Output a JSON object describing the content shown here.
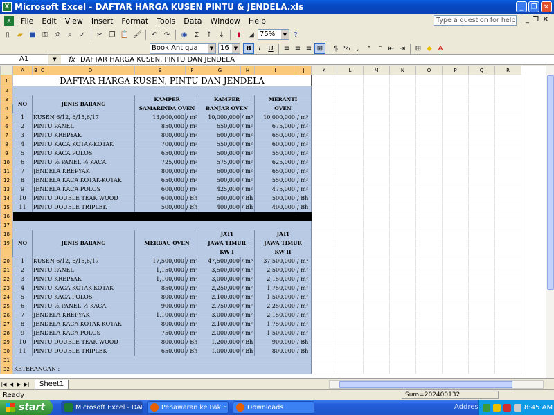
{
  "window": {
    "title": "Microsoft Excel - DAFTAR HARGA KUSEN PINTU & JENDELA.xls"
  },
  "menu": {
    "items": [
      "File",
      "Edit",
      "View",
      "Insert",
      "Format",
      "Tools",
      "Data",
      "Window",
      "Help"
    ],
    "help_placeholder": "Type a question for help"
  },
  "toolbar": {
    "zoom": "75%"
  },
  "format_toolbar": {
    "font": "Book Antiqua",
    "size": "16",
    "bold": "B",
    "italic": "I",
    "underline": "U",
    "currency": "$",
    "percent": "%"
  },
  "formula_bar": {
    "cell": "A1",
    "fx": "fx",
    "content": "DAFTAR HARGA KUSEN, PINTU DAN JENDELA"
  },
  "columns": [
    "A",
    "B",
    "C",
    "D",
    "E",
    "F",
    "G",
    "H",
    "I",
    "J",
    "K",
    "L",
    "M",
    "N",
    "O",
    "P",
    "Q",
    "R"
  ],
  "sheet": {
    "title": "DAFTAR HARGA KUSEN, PINTU DAN JENDELA",
    "table1": {
      "headers": {
        "no": "NO",
        "item": "JENIS BARANG",
        "c1a": "KAMPER",
        "c1b": "SAMARINDA OVEN",
        "c2a": "KAMPER",
        "c2b": "BANJAR OVEN",
        "c3a": "MERANTI",
        "c3b": "OVEN"
      },
      "rows": [
        [
          "1",
          "KUSEN 6/12, 6/15,6/17",
          "13,000,000",
          "/ m³",
          "10,000,000",
          "/ m³",
          "10,000,000",
          "/ m³"
        ],
        [
          "2",
          "PINTU PANEL",
          "850,000",
          "/ m²",
          "650,000",
          "/ m²",
          "675,000",
          "/ m²"
        ],
        [
          "3",
          "PINTU KREPYAK",
          "800,000",
          "/ m²",
          "600,000",
          "/ m²",
          "650,000",
          "/ m²"
        ],
        [
          "4",
          "PINTU KACA KOTAK-KOTAK",
          "700,000",
          "/ m²",
          "550,000",
          "/ m²",
          "600,000",
          "/ m²"
        ],
        [
          "5",
          "PINTU KACA POLOS",
          "650,000",
          "/ m²",
          "500,000",
          "/ m²",
          "550,000",
          "/ m²"
        ],
        [
          "6",
          "PINTU ½ PANEL ½ KACA",
          "725,000",
          "/ m²",
          "575,000",
          "/ m²",
          "625,000",
          "/ m²"
        ],
        [
          "7",
          "JENDELA KREPYAK",
          "800,000",
          "/ m²",
          "600,000",
          "/ m²",
          "650,000",
          "/ m²"
        ],
        [
          "8",
          "JENDELA KACA KOTAK-KOTAK",
          "650,000",
          "/ m²",
          "500,000",
          "/ m²",
          "550,000",
          "/ m²"
        ],
        [
          "9",
          "JENDELA KACA POLOS",
          "600,000",
          "/ m²",
          "425,000",
          "/ m²",
          "475,000",
          "/ m²"
        ],
        [
          "10",
          "PINTU DOUBLE TEAK WOOD",
          "600,000",
          "/ Bh",
          "500,000",
          "/ Bh",
          "500,000",
          "/ Bh"
        ],
        [
          "11",
          "PINTU DOUBLE TRIPLEK",
          "500,000",
          "/ Bh",
          "400,000",
          "/ Bh",
          "400,000",
          "/ Bh"
        ]
      ]
    },
    "table2": {
      "headers": {
        "no": "NO",
        "item": "JENIS BARANG",
        "c1a": "MERBAU OVEN",
        "c2a": "JATI",
        "c2b": "JAWA TIMUR",
        "c2c": "KW I",
        "c3a": "JATI",
        "c3b": "JAWA TIMUR",
        "c3c": "KW II"
      },
      "rows": [
        [
          "1",
          "KUSEN 6/12, 6/15,6/17",
          "17,500,000",
          "/ m³",
          "47,500,000",
          "/ m³",
          "37,500,000",
          "/ m³"
        ],
        [
          "2",
          "PINTU PANEL",
          "1,150,000",
          "/ m²",
          "3,500,000",
          "/ m²",
          "2,500,000",
          "/ m²"
        ],
        [
          "3",
          "PINTU KREPYAK",
          "1,100,000",
          "/ m²",
          "3,000,000",
          "/ m²",
          "2,150,000",
          "/ m²"
        ],
        [
          "4",
          "PINTU KACA KOTAK-KOTAK",
          "850,000",
          "/ m²",
          "2,250,000",
          "/ m²",
          "1,750,000",
          "/ m²"
        ],
        [
          "5",
          "PINTU KACA POLOS",
          "800,000",
          "/ m²",
          "2,100,000",
          "/ m²",
          "1,500,000",
          "/ m²"
        ],
        [
          "6",
          "PINTU ½ PANEL ½ KACA",
          "900,000",
          "/ m²",
          "2,750,000",
          "/ m²",
          "2,250,000",
          "/ m²"
        ],
        [
          "7",
          "JENDELA KREPYAK",
          "1,100,000",
          "/ m²",
          "3,000,000",
          "/ m²",
          "2,150,000",
          "/ m²"
        ],
        [
          "8",
          "JENDELA KACA KOTAK-KOTAK",
          "800,000",
          "/ m²",
          "2,100,000",
          "/ m²",
          "1,750,000",
          "/ m²"
        ],
        [
          "9",
          "JENDELA KACA POLOS",
          "750,000",
          "/ m²",
          "2,000,000",
          "/ m²",
          "1,500,000",
          "/ m²"
        ],
        [
          "10",
          "PINTU DOUBLE TEAK WOOD",
          "800,000",
          "/ Bh",
          "1,200,000",
          "/ Bh",
          "900,000",
          "/ Bh"
        ],
        [
          "11",
          "PINTU DOUBLE TRIPLEK",
          "650,000",
          "/ Bh",
          "1,000,000",
          "/ Bh",
          "800,000",
          "/ Bh"
        ]
      ]
    },
    "footer": "KETERANGAN :"
  },
  "tabs": {
    "sheet1": "Sheet1"
  },
  "status": {
    "ready": "Ready",
    "sum": "Sum=202400132"
  },
  "taskbar": {
    "start": "start",
    "tasks": [
      "Microsoft Excel - DAF...",
      "Penawaran ke Pak Ek...",
      "Downloads"
    ],
    "address": "Address",
    "time": "8:45 AM"
  }
}
